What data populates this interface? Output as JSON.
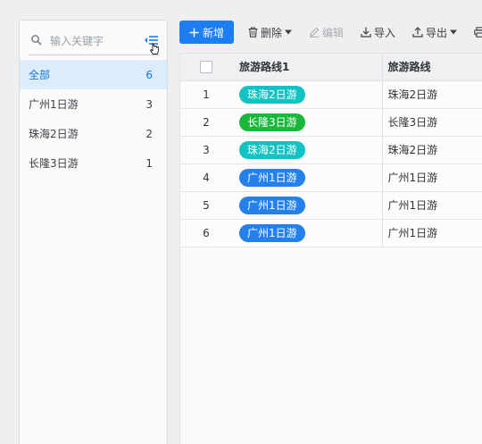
{
  "sidebar": {
    "search": {
      "placeholder": "输入关键字",
      "value": ""
    },
    "items": [
      {
        "label": "全部",
        "count": "6",
        "active": true
      },
      {
        "label": "广州1日游",
        "count": "3",
        "active": false
      },
      {
        "label": "珠海2日游",
        "count": "2",
        "active": false
      },
      {
        "label": "长隆3日游",
        "count": "1",
        "active": false
      }
    ]
  },
  "toolbar": {
    "add_label": "新增",
    "delete_label": "删除",
    "edit_label": "编辑",
    "import_label": "导入",
    "export_label": "导出"
  },
  "table": {
    "headers": {
      "route1": "旅游路线1",
      "route": "旅游路线"
    },
    "rows": [
      {
        "index": "1",
        "tag": "珠海2日游",
        "tag_color": "#13c2c2",
        "route": "珠海2日游"
      },
      {
        "index": "2",
        "tag": "长隆3日游",
        "tag_color": "#19b83a",
        "route": "长隆3日游"
      },
      {
        "index": "3",
        "tag": "珠海2日游",
        "tag_color": "#13c2c2",
        "route": "珠海2日游"
      },
      {
        "index": "4",
        "tag": "广州1日游",
        "tag_color": "#2480ea",
        "route": "广州1日游"
      },
      {
        "index": "5",
        "tag": "广州1日游",
        "tag_color": "#2480ea",
        "route": "广州1日游"
      },
      {
        "index": "6",
        "tag": "广州1日游",
        "tag_color": "#2480ea",
        "route": "广州1日游"
      }
    ]
  },
  "colors": {
    "accent": "#1c7ef0",
    "active_bg": "#dcecfb"
  }
}
